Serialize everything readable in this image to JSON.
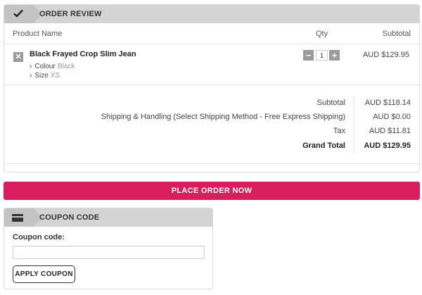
{
  "order_review": {
    "title": "ORDER REVIEW",
    "icon": "check-icon",
    "columns": {
      "product": "Product Name",
      "qty": "Qty",
      "subtotal": "Subtotal"
    },
    "items": [
      {
        "name": "Black Frayed Crop Slim Jean",
        "options": [
          {
            "label": "Colour",
            "value": "Black"
          },
          {
            "label": "Size",
            "value": "XS"
          }
        ],
        "qty": "1",
        "subtotal": "AUD $129.95"
      }
    ],
    "totals": [
      {
        "label": "Subtotal",
        "value": "AUD $118.14"
      },
      {
        "label": "Shipping & Handling (Select Shipping Method - Free Express Shipping)",
        "value": "AUD $0.00"
      },
      {
        "label": "Tax",
        "value": "AUD $11.81"
      },
      {
        "label": "Grand Total",
        "value": "AUD $129.95"
      }
    ]
  },
  "place_order": {
    "label": "PLACE ORDER NOW",
    "color": "#d81f5e"
  },
  "coupon": {
    "title": "COUPON CODE",
    "icon": "credit-card-icon",
    "field_label": "Coupon code:",
    "value": "",
    "placeholder": "",
    "apply_label": "APPLY COUPON"
  }
}
